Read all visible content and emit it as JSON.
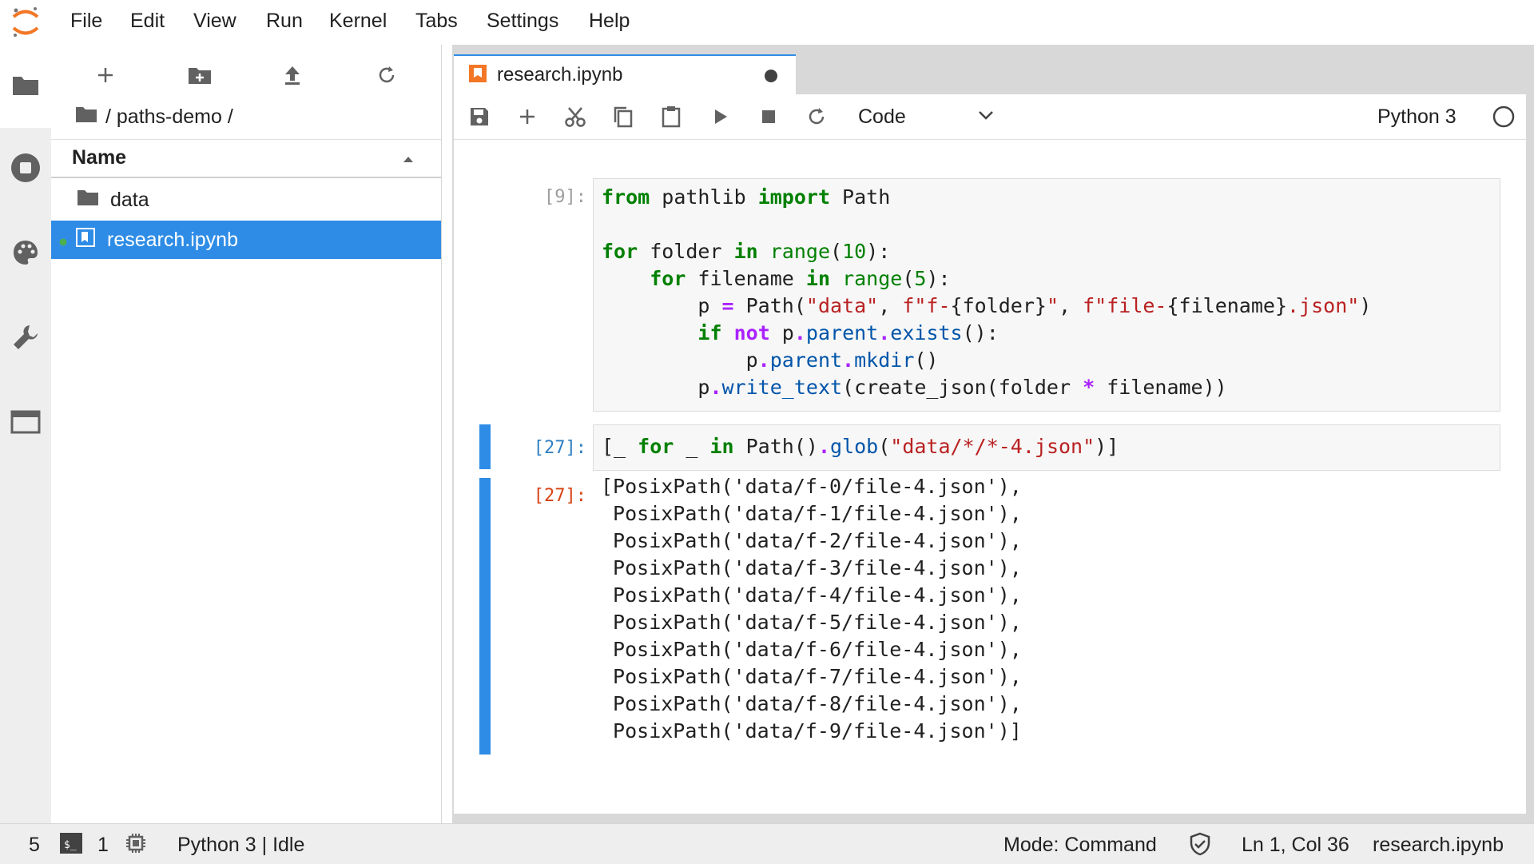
{
  "menu": {
    "items": [
      "File",
      "Edit",
      "View",
      "Run",
      "Kernel",
      "Tabs",
      "Settings",
      "Help"
    ]
  },
  "sidebar": {
    "icons": [
      "folder-icon",
      "running-icon",
      "palette-icon",
      "wrench-icon",
      "tabs-icon"
    ]
  },
  "filebrowser": {
    "breadcrumb": "/ paths-demo /",
    "column_name": "Name",
    "items": [
      {
        "name": "data",
        "type": "folder"
      },
      {
        "name": "research.ipynb",
        "type": "notebook"
      }
    ]
  },
  "tab": {
    "title": "research.ipynb"
  },
  "toolbar": {
    "cell_type": "Code",
    "kernel": "Python 3"
  },
  "cells": {
    "cell1_prompt": "[9]:",
    "cell2_prompt": "[27]:",
    "out2_prompt": "[27]:",
    "output": "[PosixPath('data/f-0/file-4.json'),\n PosixPath('data/f-1/file-4.json'),\n PosixPath('data/f-2/file-4.json'),\n PosixPath('data/f-3/file-4.json'),\n PosixPath('data/f-4/file-4.json'),\n PosixPath('data/f-5/file-4.json'),\n PosixPath('data/f-6/file-4.json'),\n PosixPath('data/f-7/file-4.json'),\n PosixPath('data/f-8/file-4.json'),\n PosixPath('data/f-9/file-4.json')]"
  },
  "status": {
    "count_left": "5",
    "terminal_count": "1",
    "kernel_status": "Python 3 | Idle",
    "mode": "Mode: Command",
    "cursor": "Ln 1, Col 36",
    "filename": "research.ipynb"
  },
  "colors": {
    "accent": "#2e8ce6",
    "logo": "#f37726",
    "keyword": "#008000",
    "string": "#ba2121",
    "operator": "#aa22ff"
  }
}
